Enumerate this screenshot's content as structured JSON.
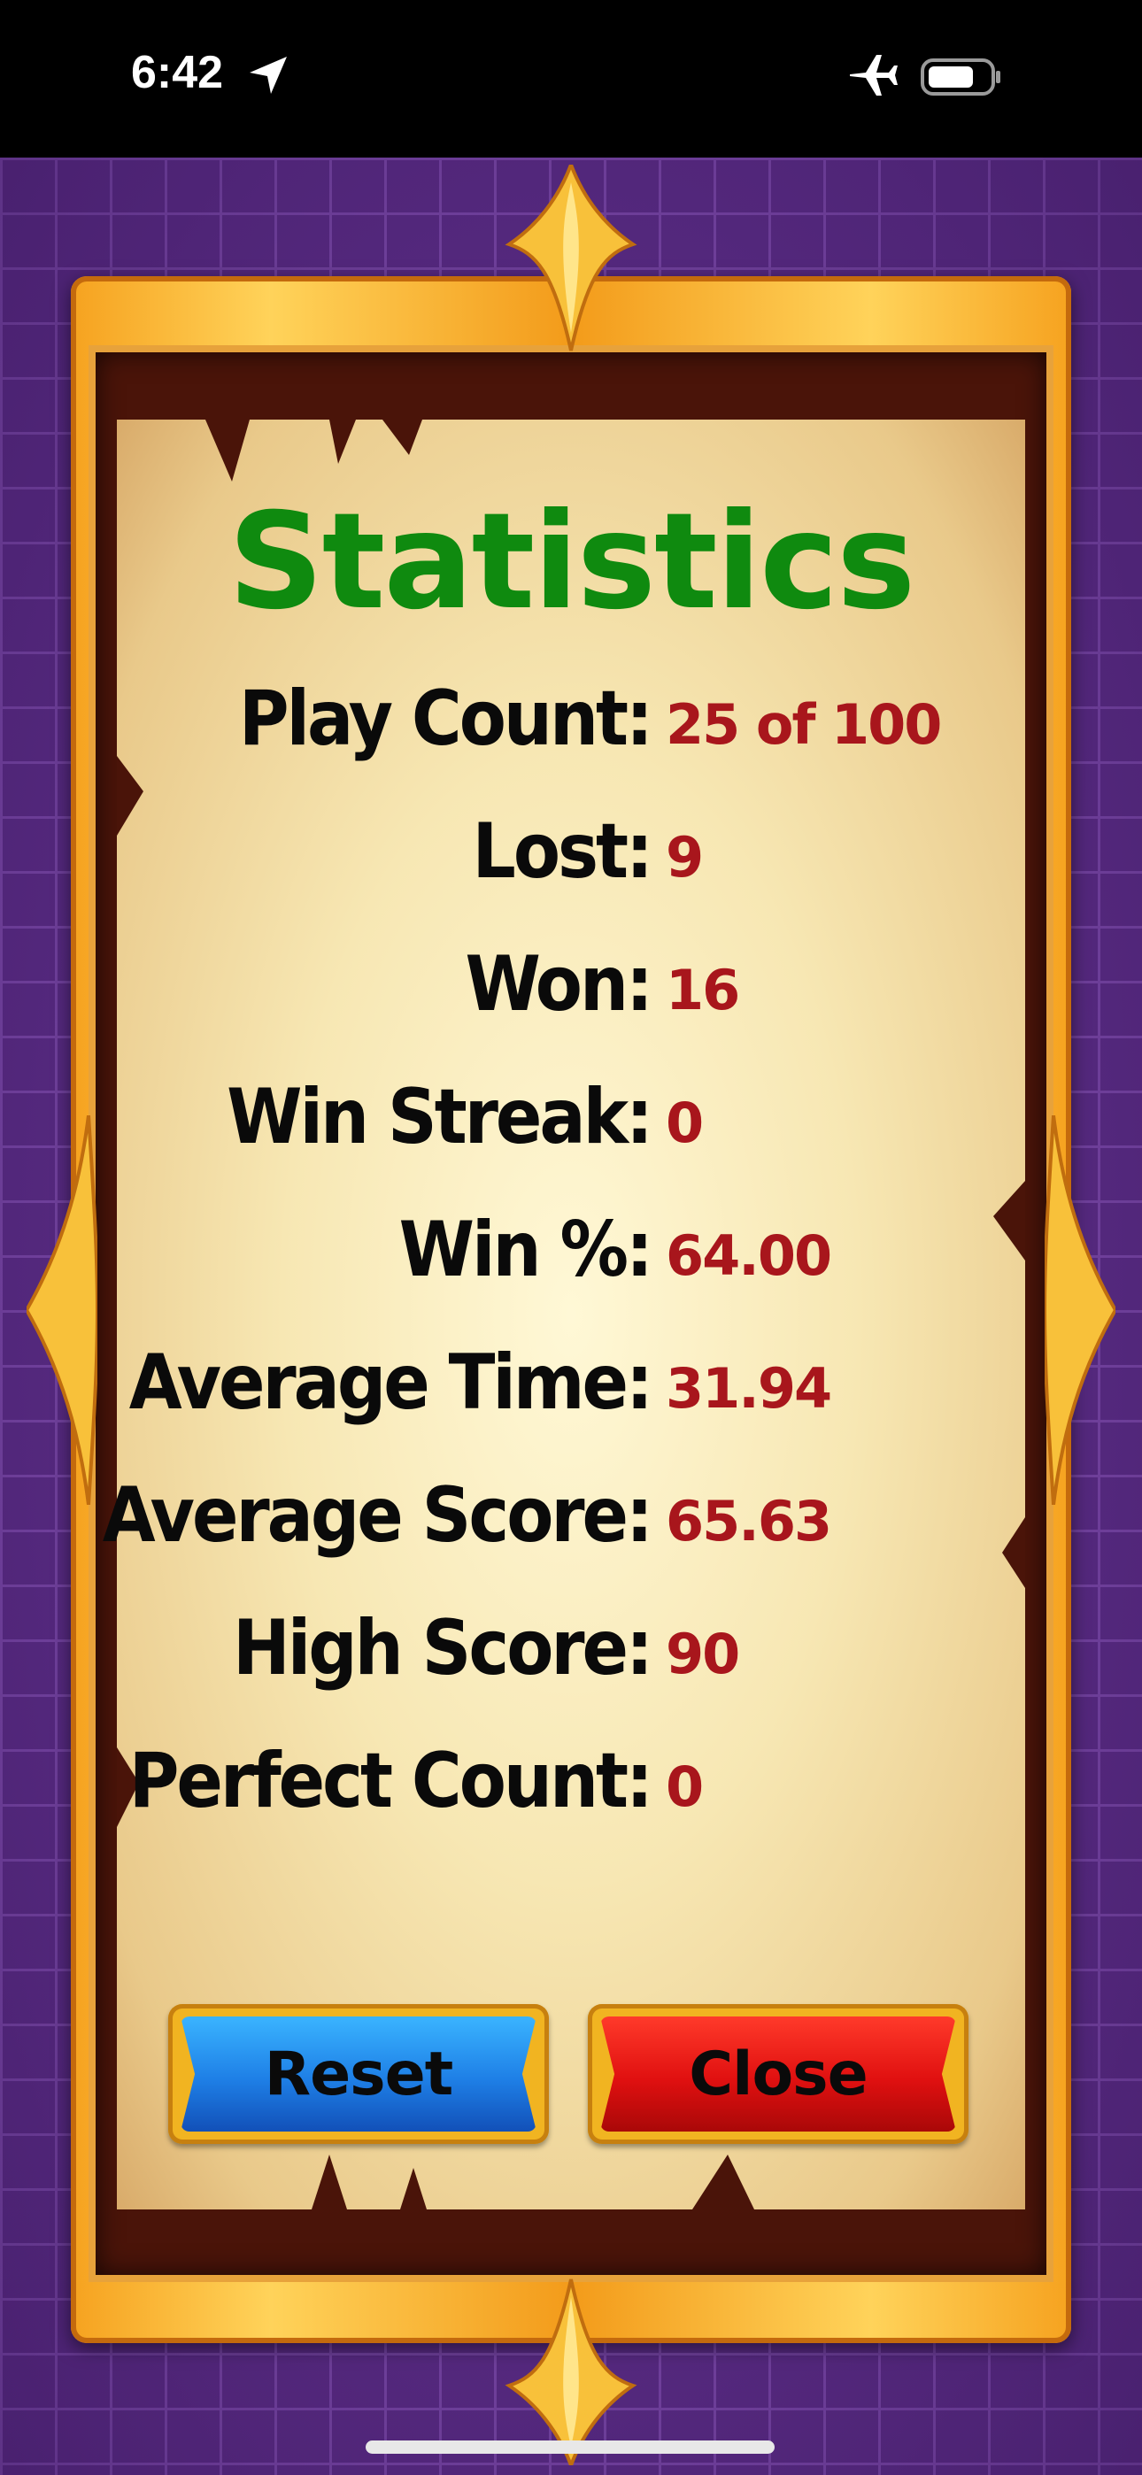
{
  "status_bar": {
    "time": "6:42",
    "icons": [
      "location-arrow-icon",
      "airplane-icon",
      "battery-icon"
    ]
  },
  "dialog": {
    "title": "Statistics",
    "stats": [
      {
        "label": "Play Count:",
        "value": "25 of 100"
      },
      {
        "label": "Lost:",
        "value": "9"
      },
      {
        "label": "Won:",
        "value": "16"
      },
      {
        "label": "Win Streak:",
        "value": "0"
      },
      {
        "label": "Win %:",
        "value": "64.00"
      },
      {
        "label": "Average Time:",
        "value": "31.94"
      },
      {
        "label": "Average Score:",
        "value": "65.63"
      },
      {
        "label": "High Score:",
        "value": "90"
      },
      {
        "label": "Perfect Count:",
        "value": "0"
      }
    ],
    "buttons": {
      "reset": "Reset",
      "close": "Close"
    }
  },
  "colors": {
    "title": "#0f8a0f",
    "value": "#a8161c",
    "background": "#5b2d86",
    "frame_gold": "#f6a21f"
  }
}
